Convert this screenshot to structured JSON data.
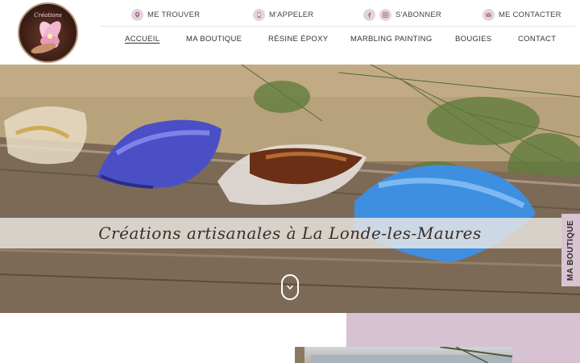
{
  "topbar": {
    "find_label": "ME TROUVER",
    "call_label": "M'APPELER",
    "subscribe_label": "S'ABONNER",
    "contact_label": "ME CONTACTER"
  },
  "logo": {
    "text": "Créations"
  },
  "nav": {
    "items": [
      {
        "label": "ACCUEIL",
        "active": true
      },
      {
        "label": "MA BOUTIQUE"
      },
      {
        "label": "RÉSINE ÉPOXY"
      },
      {
        "label": "MARBLING PAINTING"
      },
      {
        "label": "BOUGIES"
      },
      {
        "label": "CONTACT"
      }
    ]
  },
  "hero": {
    "tagline": "Créations artisanales à La Londe-les-Maures"
  },
  "side_tab": {
    "label": "MA BOUTIQUE"
  },
  "colors": {
    "accent_pink": "#d8c3d0",
    "icon_bg": "#e6d2de",
    "text_dark": "#333333"
  }
}
